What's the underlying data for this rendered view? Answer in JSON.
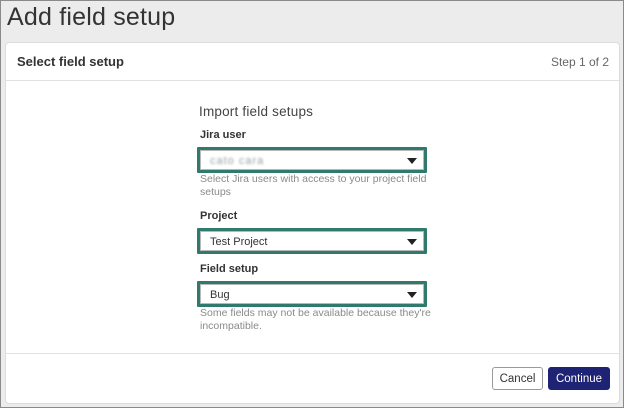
{
  "page": {
    "title": "Add field setup"
  },
  "dialog": {
    "title": "Select field setup",
    "step": "Step 1 of 2",
    "section_heading": "Import field setups"
  },
  "fields": {
    "jira_user": {
      "label": "Jira user",
      "value": "cato cara",
      "help": "Select Jira users with access to your project field setups"
    },
    "project": {
      "label": "Project",
      "value": "Test Project"
    },
    "field_setup": {
      "label": "Field setup",
      "value": "Bug",
      "help": "Some fields may not be available because they're incompatible."
    }
  },
  "footer": {
    "cancel_label": "Cancel",
    "continue_label": "Continue"
  },
  "colors": {
    "highlight_border": "#2f7a6c",
    "primary_button": "#1f2373"
  }
}
